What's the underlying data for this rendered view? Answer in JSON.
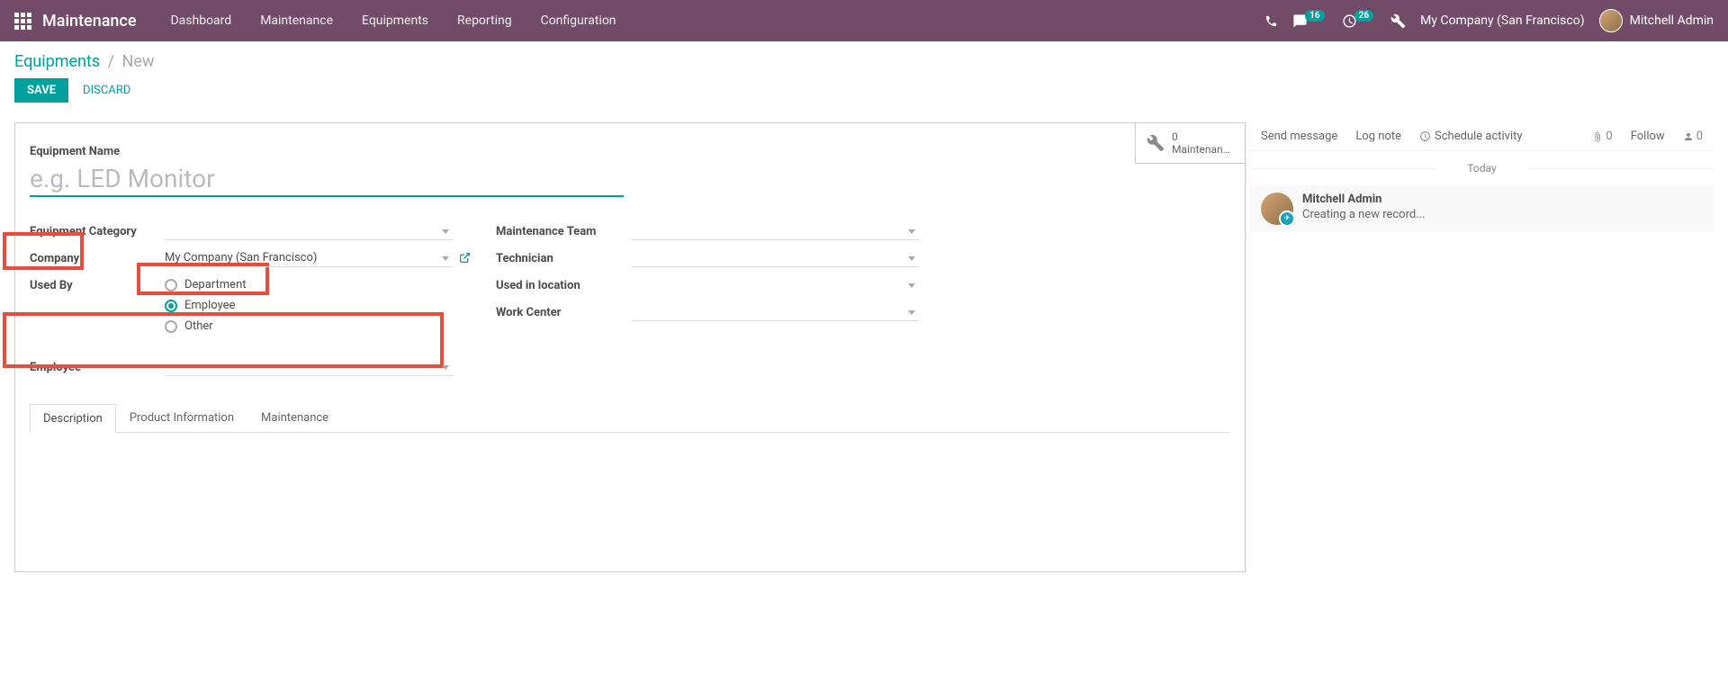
{
  "nav": {
    "brand": "Maintenance",
    "menu": [
      "Dashboard",
      "Maintenance",
      "Equipments",
      "Reporting",
      "Configuration"
    ],
    "messages_badge": "16",
    "activities_badge": "26",
    "company": "My Company (San Francisco)",
    "user": "Mitchell Admin"
  },
  "breadcrumb": {
    "root": "Equipments",
    "current": "New"
  },
  "actions": {
    "save": "SAVE",
    "discard": "DISCARD"
  },
  "stat": {
    "count": "0",
    "label": "Maintenan…"
  },
  "form": {
    "name_label": "Equipment Name",
    "name_placeholder": "e.g. LED Monitor",
    "category_label": "Equipment Category",
    "company_label": "Company",
    "company_value": "My Company (San Francisco)",
    "used_by_label": "Used By",
    "used_by_options": {
      "department": "Department",
      "employee": "Employee",
      "other": "Other"
    },
    "employee_label": "Employee",
    "team_label": "Maintenance Team",
    "technician_label": "Technician",
    "location_label": "Used in location",
    "workcenter_label": "Work Center"
  },
  "tabs": [
    "Description",
    "Product Information",
    "Maintenance"
  ],
  "chatter": {
    "send": "Send message",
    "log": "Log note",
    "schedule": "Schedule activity",
    "attach": "0",
    "follow": "Follow",
    "followers": "0",
    "today": "Today",
    "author": "Mitchell Admin",
    "msg": "Creating a new record..."
  }
}
